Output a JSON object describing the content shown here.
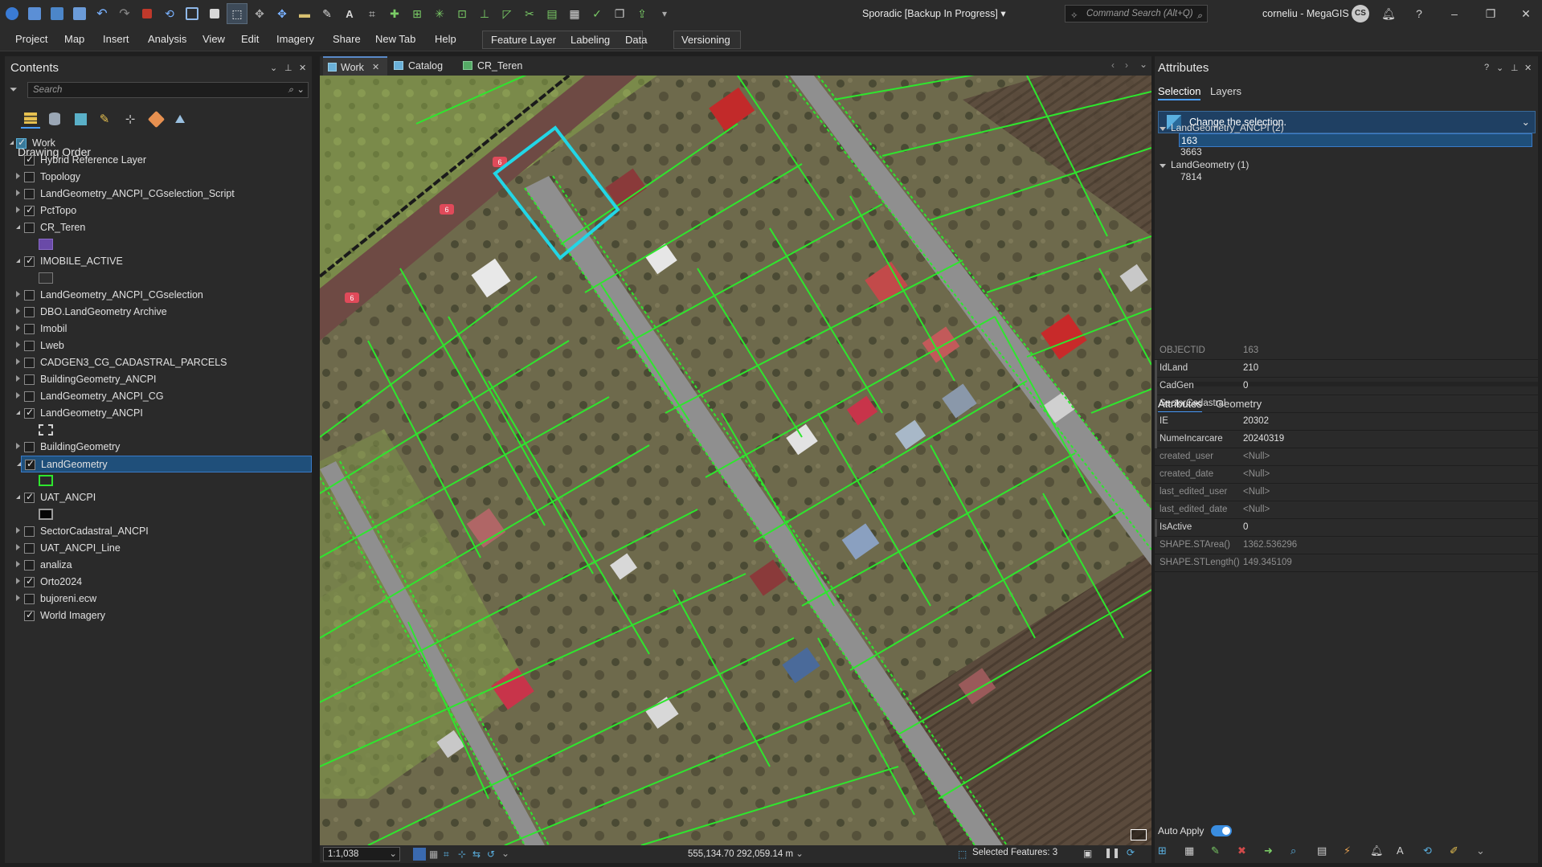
{
  "app": {
    "project_title": "Sporadic [Backup In Progress]",
    "command_search_placeholder": "Command Search (Alt+Q)",
    "user": "corneliu - MegaGIS",
    "user_initials": "CS"
  },
  "menu": {
    "items": [
      "Project",
      "Map",
      "Insert",
      "Analysis",
      "View",
      "Edit",
      "Imagery",
      "Share",
      "New Tab",
      "Help"
    ],
    "contextual": [
      "Feature Layer",
      "Labeling",
      "Data"
    ],
    "versioning": "Versioning"
  },
  "contents": {
    "title": "Contents",
    "search_placeholder": "Search",
    "drawing_order": "Drawing Order",
    "layers": [
      {
        "label": "Work",
        "level": 0,
        "expander": "open",
        "checked": true,
        "kind": "map"
      },
      {
        "label": "Hybrid Reference Layer",
        "level": 1,
        "expander": "none",
        "checked": true
      },
      {
        "label": "Topology",
        "level": 1,
        "expander": "closed",
        "checked": false
      },
      {
        "label": "LandGeometry_ANCPI_CGselection_Script",
        "level": 1,
        "expander": "closed",
        "checked": false
      },
      {
        "label": "PctTopo",
        "level": 1,
        "expander": "closed",
        "checked": true
      },
      {
        "label": "CR_Teren",
        "level": 1,
        "expander": "open",
        "checked": false,
        "swatch": "purple"
      },
      {
        "label": "IMOBILE_ACTIVE",
        "level": 1,
        "expander": "open",
        "checked": true,
        "swatch": "empty"
      },
      {
        "label": "LandGeometry_ANCPI_CGselection",
        "level": 1,
        "expander": "closed",
        "checked": false
      },
      {
        "label": "DBO.LandGeometry Archive",
        "level": 1,
        "expander": "closed",
        "checked": false
      },
      {
        "label": "Imobil",
        "level": 1,
        "expander": "closed",
        "checked": false
      },
      {
        "label": "Lweb",
        "level": 1,
        "expander": "closed",
        "checked": false
      },
      {
        "label": "CADGEN3_CG_CADASTRAL_PARCELS",
        "level": 1,
        "expander": "closed",
        "checked": false
      },
      {
        "label": "BuildingGeometry_ANCPI",
        "level": 1,
        "expander": "closed",
        "checked": false
      },
      {
        "label": "LandGeometry_ANCPI_CG",
        "level": 1,
        "expander": "closed",
        "checked": false
      },
      {
        "label": "LandGeometry_ANCPI",
        "level": 1,
        "expander": "open",
        "checked": true,
        "swatch": "dashed"
      },
      {
        "label": "BuildingGeometry",
        "level": 1,
        "expander": "closed",
        "checked": false
      },
      {
        "label": "LandGeometry",
        "level": 1,
        "expander": "open",
        "checked": true,
        "swatch": "green",
        "selected": true
      },
      {
        "label": "UAT_ANCPI",
        "level": 1,
        "expander": "open",
        "checked": true,
        "swatch": "black"
      },
      {
        "label": "SectorCadastral_ANCPI",
        "level": 1,
        "expander": "closed",
        "checked": false
      },
      {
        "label": "UAT_ANCPI_Line",
        "level": 1,
        "expander": "closed",
        "checked": false
      },
      {
        "label": "analiza",
        "level": 1,
        "expander": "closed",
        "checked": false
      },
      {
        "label": "Orto2024",
        "level": 1,
        "expander": "closed",
        "checked": true
      },
      {
        "label": "bujoreni.ecw",
        "level": 1,
        "expander": "closed",
        "checked": false
      },
      {
        "label": "World Imagery",
        "level": 1,
        "expander": "none",
        "checked": true
      }
    ]
  },
  "map_view": {
    "tabs": [
      {
        "label": "Work",
        "active": true,
        "closable": true
      },
      {
        "label": "Catalog",
        "active": false
      },
      {
        "label": "CR_Teren",
        "active": false
      }
    ],
    "road_labels": [
      "6",
      "6",
      "6"
    ],
    "scale": "1:1,038",
    "coordinates": "555,134.70 292,059.14 m",
    "selected_features": "Selected Features: 3",
    "colors": {
      "parcel_outline": "#2ee62e",
      "selection": "#22d6e6"
    }
  },
  "attributes": {
    "title": "Attributes",
    "tabs": [
      "Selection",
      "Layers"
    ],
    "change_selection": "Change the selection.",
    "tree": [
      {
        "label": "LandGeometry_ANCPI (2)",
        "kind": "group"
      },
      {
        "label": "163",
        "kind": "item",
        "selected": true
      },
      {
        "label": "3663",
        "kind": "item"
      },
      {
        "label": "LandGeometry (1)",
        "kind": "group"
      },
      {
        "label": "7814",
        "kind": "item"
      }
    ],
    "detail_tabs": [
      "Attributes",
      "Geometry"
    ],
    "fields": [
      {
        "name": "OBJECTID",
        "value": "163",
        "readonly": true
      },
      {
        "name": "IdLand",
        "value": "210"
      },
      {
        "name": "CadGen",
        "value": "0"
      },
      {
        "name": "SectorCadastral",
        "value": ""
      },
      {
        "name": "IE",
        "value": "20302"
      },
      {
        "name": "NumeIncarcare",
        "value": "20240319"
      },
      {
        "name": "created_user",
        "value": "<Null>",
        "readonly": true
      },
      {
        "name": "created_date",
        "value": "<Null>",
        "readonly": true
      },
      {
        "name": "last_edited_user",
        "value": "<Null>",
        "readonly": true
      },
      {
        "name": "last_edited_date",
        "value": "<Null>",
        "readonly": true
      },
      {
        "name": "IsActive",
        "value": "0"
      },
      {
        "name": "SHAPE.STArea()",
        "value": "1362.536296",
        "readonly": true
      },
      {
        "name": "SHAPE.STLength()",
        "value": "149.345109",
        "readonly": true
      }
    ],
    "auto_apply": "Auto Apply"
  }
}
